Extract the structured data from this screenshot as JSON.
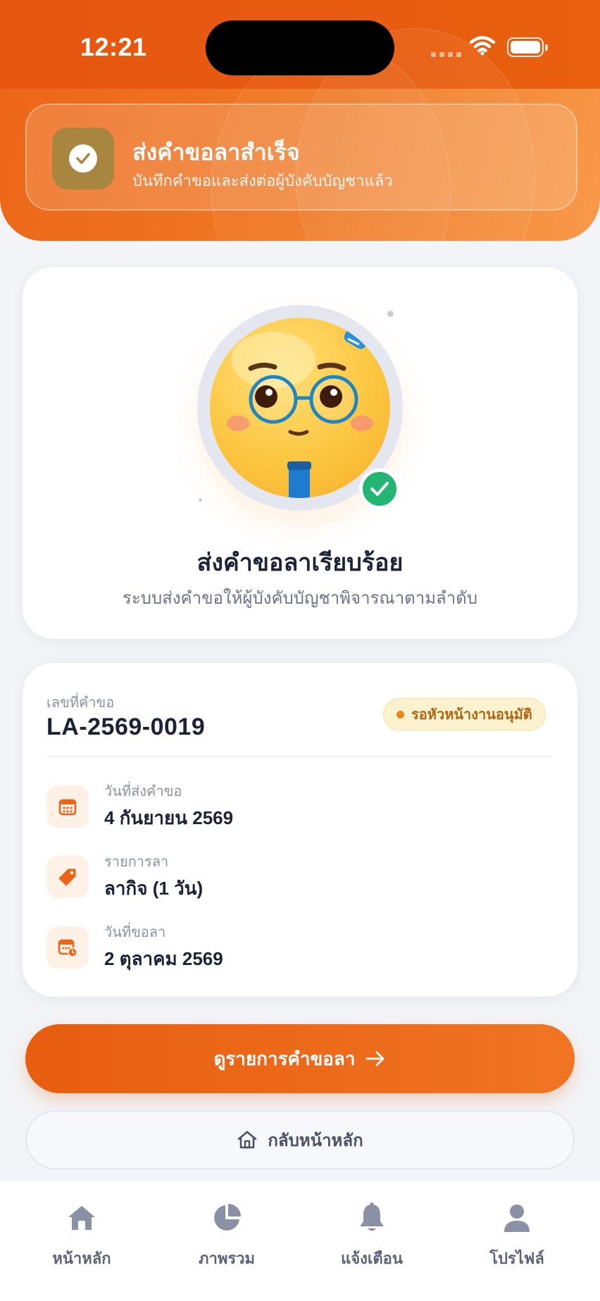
{
  "status_bar": {
    "time": "12:21"
  },
  "toast": {
    "title": "ส่งคำขอลาสำเร็จ",
    "subtitle": "บันทึกคำขอและส่งต่อผู้บังคับบัญชาแล้ว",
    "icon": "check-circle-icon"
  },
  "hero": {
    "title": "ส่งคำขอลาเรียบร้อย",
    "subtitle": "ระบบส่งคำขอให้ผู้บังคับบัญชาพิจารณาตามลำดับ"
  },
  "request": {
    "number_label": "เลขที่คำขอ",
    "number": "LA-2569-0019",
    "status": "รอหัวหน้างานอนุมัติ",
    "rows": [
      {
        "label": "วันที่ส่งคำขอ",
        "value": "4 กันยายน 2569",
        "icon": "calendar-icon"
      },
      {
        "label": "รายการลา",
        "value": "ลากิจ (1 วัน)",
        "icon": "tag-icon"
      },
      {
        "label": "วันที่ขอลา",
        "value": "2 ตุลาคม 2569",
        "icon": "calendar-clock-icon"
      }
    ]
  },
  "actions": {
    "primary_label": "ดูรายการคำขอลา",
    "secondary_label": "กลับหน้าหลัก"
  },
  "tabs": [
    {
      "label": "หน้าหลัก",
      "icon": "home-icon"
    },
    {
      "label": "ภาพรวม",
      "icon": "pie-chart-icon"
    },
    {
      "label": "แจ้งเตือน",
      "icon": "bell-icon"
    },
    {
      "label": "โปรไฟล์",
      "icon": "user-icon"
    }
  ],
  "colors": {
    "brand_orange": "#ec6516",
    "success_green": "#22b573",
    "status_amber": "#e9861d",
    "text_dark": "#1c2338"
  }
}
